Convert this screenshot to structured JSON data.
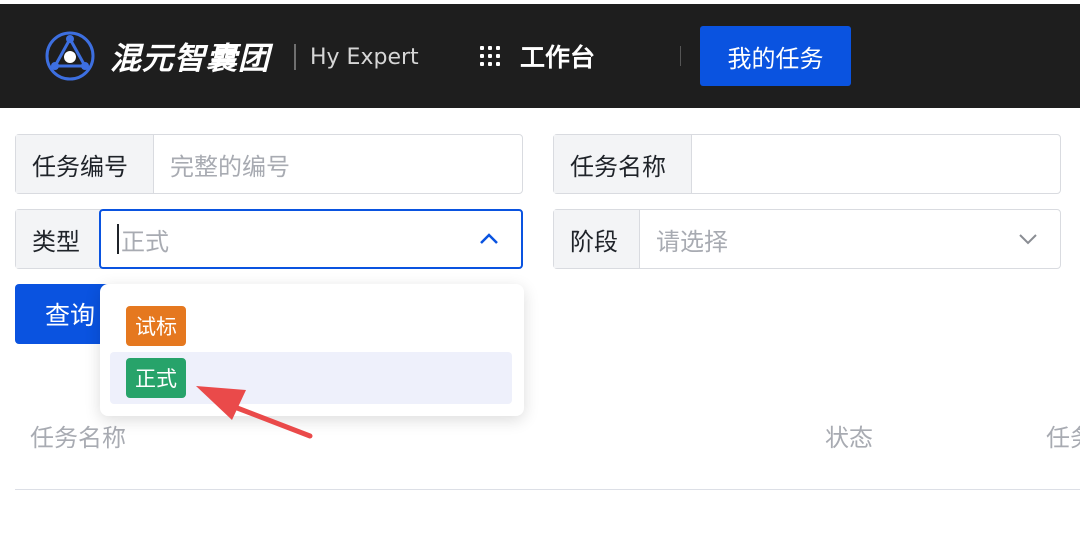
{
  "header": {
    "brand_name": "混元智囊团",
    "brand_sub": "Hy Expert",
    "nav_workbench": "工作台",
    "nav_my_tasks": "我的任务",
    "bg_color": "#1e1e1e",
    "accent": "#0a53e0"
  },
  "filters": {
    "task_id": {
      "label": "任务编号",
      "placeholder": "完整的编号"
    },
    "task_name": {
      "label": "任务名称",
      "value": ""
    },
    "type": {
      "label": "类型",
      "placeholder": "正式"
    },
    "stage": {
      "label": "阶段",
      "placeholder": "请选择"
    }
  },
  "query_button": "查询",
  "type_dropdown": {
    "options": [
      {
        "label": "试标",
        "color": "#e5781f"
      },
      {
        "label": "正式",
        "color": "#27a36a"
      }
    ],
    "highlighted": "正式"
  },
  "table": {
    "columns": [
      "任务名称",
      "状态",
      "任务"
    ]
  },
  "annotation": {
    "arrow_color": "#ea4a4a"
  }
}
